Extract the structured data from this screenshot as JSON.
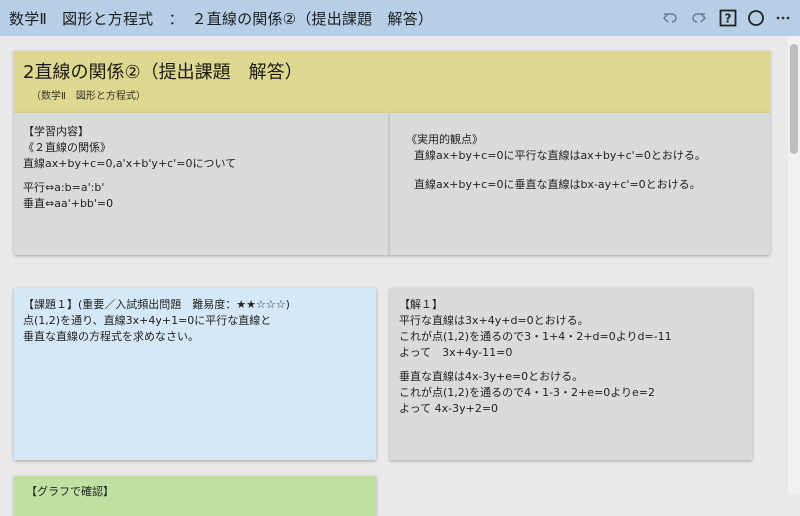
{
  "topbar": {
    "title": "数学Ⅱ　図形と方程式　：　２直線の関係②（提出課題　解答）",
    "icons": [
      "undo-icon",
      "redo-icon",
      "help-icon",
      "circle-icon",
      "more-icon"
    ]
  },
  "header": {
    "title": "2直線の関係②（提出課題　解答）",
    "subtitle": "（数学Ⅱ　図形と方程式）"
  },
  "learning": {
    "heading": "【学習内容】",
    "topic": "《２直線の関係》",
    "line1": "直線ax+by+c=0,a'x+b'y+c'=0について",
    "parallel": "平行⇔a:b=a':b'",
    "perpendicular": "垂直⇔aa'+bb'=0"
  },
  "viewpoint": {
    "heading": "《実用的観点》",
    "line1": "直線ax+by+c=0に平行な直線はax+by+c'=0とおける。",
    "line2": "直線ax+by+c=0に垂直な直線はbx-ay+c'=0とおける。"
  },
  "task": {
    "heading": "【課題１】(重要／入試頻出問題　難易度：★★☆☆☆)",
    "line1": "点(1,2)を通り、直線3x+4y+1=0に平行な直線と",
    "line2": "垂直な直線の方程式を求めなさい。"
  },
  "answer": {
    "heading": "【解１】",
    "p1_l1": "平行な直線は3x+4y+d=0とおける。",
    "p1_l2": "これが点(1,2)を通るので3・1+4・2+d=0よりd=-11",
    "p1_l3": "よって　3x+4y-11=0",
    "p2_l1": "垂直な直線は4x-3y+e=0とおける。",
    "p2_l2": "これが点(1,2)を通るので4・1-3・2+e=0よりe=2",
    "p2_l3": "よって 4x-3y+2=0"
  },
  "graph": {
    "heading": "【グラフで確認】"
  },
  "colors": {
    "topbar": "#b6cfe6",
    "header_card": "#ded78f",
    "gray_card": "#d9dadc",
    "task_card": "#d5e8f7",
    "graph_card": "#bfe0a0"
  }
}
